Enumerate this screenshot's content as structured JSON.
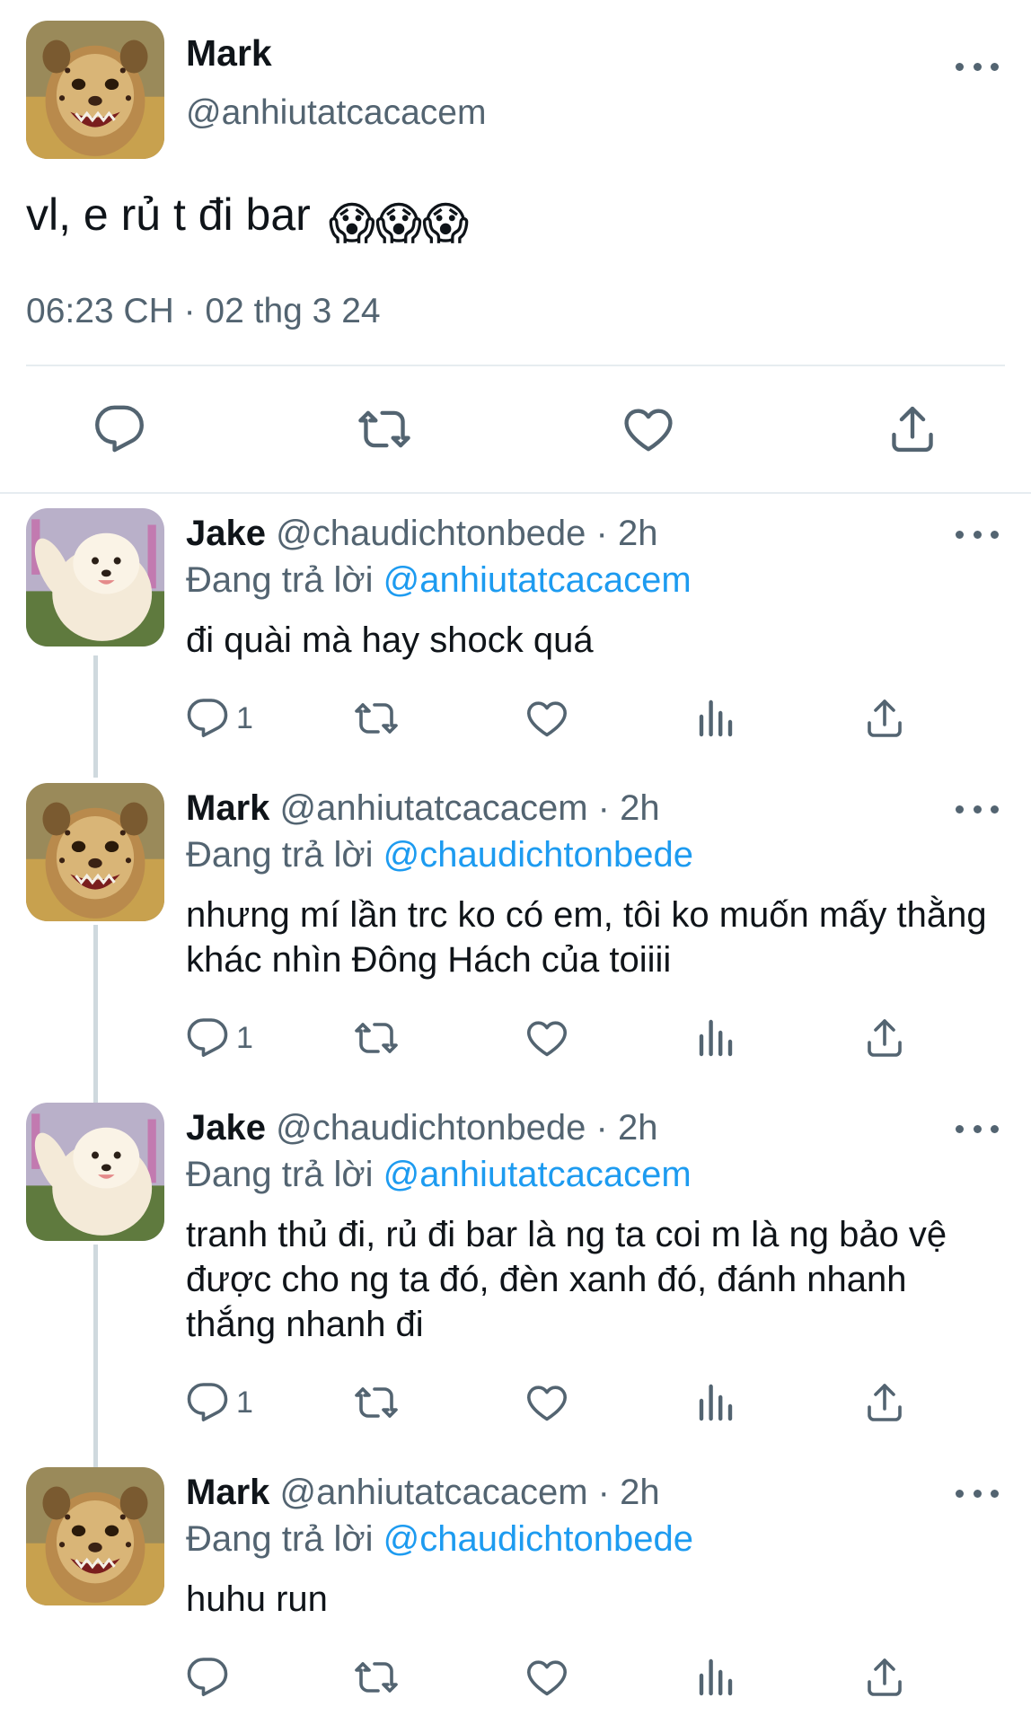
{
  "main_tweet": {
    "name": "Mark",
    "handle": "@anhiutatcacacem",
    "text": "vl, e rủ t đi bar",
    "emojis": "😱😱😱",
    "timestamp": "06:23 CH · 02 thg 3 24"
  },
  "replies": [
    {
      "name": "Jake",
      "handle_time": "@chaudichtonbede · 2h",
      "replying_prefix": "Đang trả lời",
      "replying_to": "@anhiutatcacacem",
      "text": "đi quài mà hay shock quá",
      "reply_count": "1",
      "avatar": "dog"
    },
    {
      "name": "Mark",
      "handle_time": "@anhiutatcacacem · 2h",
      "replying_prefix": "Đang trả lời",
      "replying_to": "@chaudichtonbede",
      "text": "nhưng mí lần trc ko có em, tôi ko muốn mấy thằng khác nhìn Đông Hách của toiiii",
      "reply_count": "1",
      "avatar": "cheetah"
    },
    {
      "name": "Jake",
      "handle_time": "@chaudichtonbede · 2h",
      "replying_prefix": "Đang trả lời",
      "replying_to": "@anhiutatcacacem",
      "text": "tranh thủ đi, rủ đi bar là ng ta coi m là ng bảo vệ được cho ng ta đó, đèn xanh đó, đánh nhanh thắng nhanh đi",
      "reply_count": "1",
      "avatar": "dog"
    },
    {
      "name": "Mark",
      "handle_time": "@anhiutatcacacem · 2h",
      "replying_prefix": "Đang trả lời",
      "replying_to": "@chaudichtonbede",
      "text": "huhu run",
      "reply_count": "",
      "avatar": "cheetah"
    }
  ],
  "colors": {
    "text": "#0f1419",
    "muted": "#536471",
    "link": "#1d9bf0",
    "divider": "#e6ecf0",
    "thread_line": "#cfd9de"
  },
  "icons": [
    "reply-icon",
    "retweet-icon",
    "like-icon",
    "views-icon",
    "share-icon",
    "more-icon"
  ]
}
